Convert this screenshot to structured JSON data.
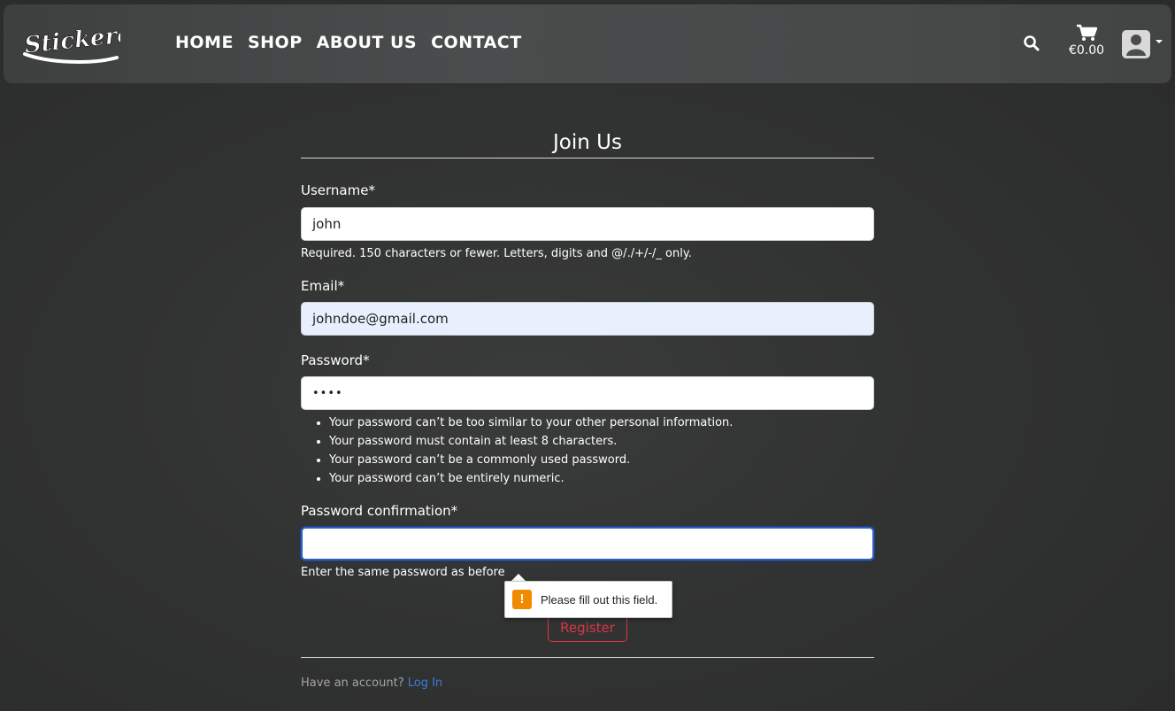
{
  "brand": {
    "logo_text": "Stickered"
  },
  "nav": {
    "links": [
      "HOME",
      "SHOP",
      "ABOUT US",
      "CONTACT"
    ],
    "cart_total": "€0.00",
    "icons": {
      "search": "search-icon",
      "cart": "cart-icon",
      "user": "user-avatar-icon",
      "dropdown": "caret-down-icon"
    }
  },
  "form": {
    "title": "Join Us",
    "username": {
      "label": "Username*",
      "value": "john",
      "help": "Required. 150 characters or fewer. Letters, digits and @/./+/-/_ only."
    },
    "email": {
      "label": "Email*",
      "value": "johndoe@gmail.com"
    },
    "password": {
      "label": "Password*",
      "value": "••••",
      "help": [
        "Your password can’t be too similar to your other personal information.",
        "Your password must contain at least 8 characters.",
        "Your password can’t be a commonly used password.",
        "Your password can’t be entirely numeric."
      ]
    },
    "password_confirmation": {
      "label": "Password confirmation*",
      "value": "",
      "help": "Enter the same password as before"
    },
    "register_label": "Register",
    "footer_text": "Have an account?",
    "login_label": "Log In"
  },
  "tooltip": {
    "message": "Please fill out this field.",
    "icon": "warning-icon"
  },
  "colors": {
    "accent_red": "#dc3545",
    "link_blue": "#3b7ddd",
    "warning_orange": "#f08a00",
    "autofill_blue": "#e8f0fe"
  }
}
